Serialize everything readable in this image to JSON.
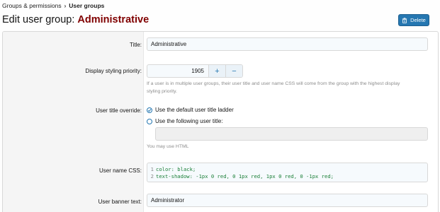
{
  "breadcrumb": {
    "parent": "Groups & permissions",
    "current": "User groups"
  },
  "page": {
    "title_prefix": "Edit user group:",
    "title_entity": "Administrative"
  },
  "actions": {
    "delete_label": "Delete"
  },
  "form": {
    "title": {
      "label": "Title:",
      "value": "Administrative"
    },
    "priority": {
      "label": "Display styling priority:",
      "value": "1905",
      "increment": "+",
      "decrement": "−",
      "hint_line1": "If a user is in multiple user groups, their user title and user name CSS will come from the group with the highest display",
      "hint_line2": "styling priority."
    },
    "title_override": {
      "label": "User title override:",
      "option_default": "Use the default user title ladder",
      "option_custom": "Use the following user title:",
      "custom_value": "",
      "hint": "You may use HTML"
    },
    "username_css": {
      "label": "User name CSS:",
      "lines": [
        {
          "num": "1",
          "code": "color: black;"
        },
        {
          "num": "2",
          "code": "text-shadow: -1px 0 red, 0 1px red, 1px 0 red, 0 -1px red;"
        }
      ]
    },
    "banner": {
      "label": "User banner text:",
      "value": "Administrator"
    }
  },
  "colors": {
    "accent": "#2577b1",
    "entity_title": "#800000"
  }
}
